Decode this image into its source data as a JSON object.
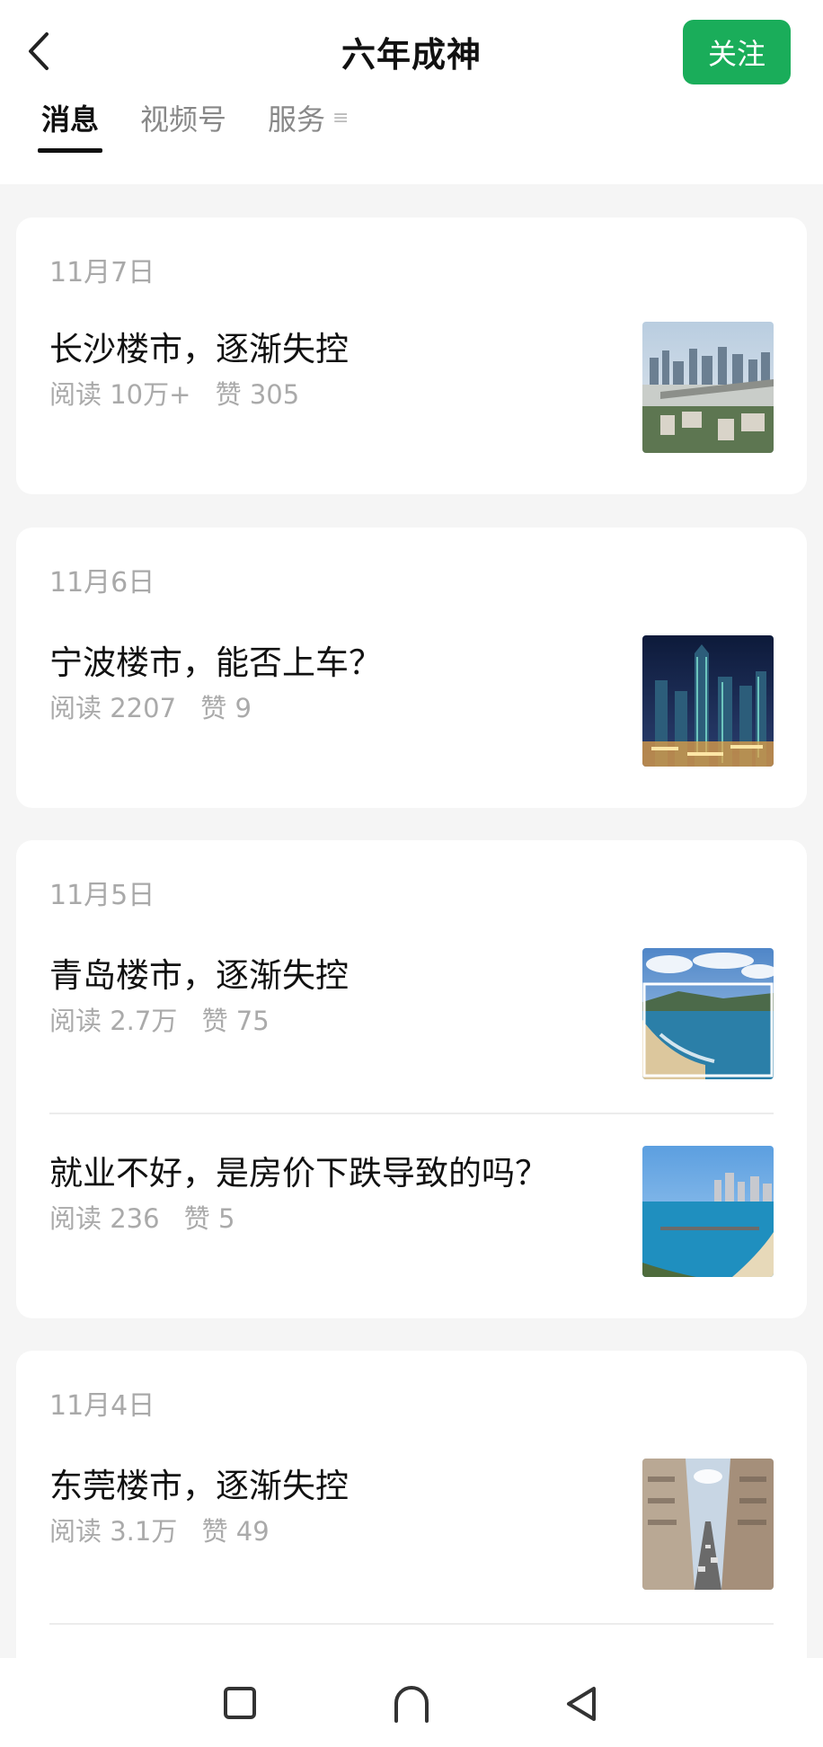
{
  "header": {
    "title": "六年成神",
    "follow_label": "关注"
  },
  "tabs": [
    {
      "label": "消息",
      "active": true
    },
    {
      "label": "视频号",
      "active": false
    },
    {
      "label": "服务",
      "active": false
    }
  ],
  "tab_more_icon": "list-icon",
  "cards": [
    {
      "date": "11月7日",
      "articles": [
        {
          "title": "长沙楼市，逐渐失控",
          "reads": "阅读 10万+",
          "likes": "赞 305",
          "thumb": "changsha-skyline-bridge"
        }
      ]
    },
    {
      "date": "11月6日",
      "articles": [
        {
          "title": "宁波楼市，能否上车？",
          "reads": "阅读 2207",
          "likes": "赞 9",
          "thumb": "ningbo-night-skyline"
        }
      ]
    },
    {
      "date": "11月5日",
      "articles": [
        {
          "title": "青岛楼市，逐渐失控",
          "reads": "阅读 2.7万",
          "likes": "赞 75",
          "thumb": "qingdao-coast"
        },
        {
          "title": "就业不好，是房价下跌导致的吗？",
          "reads": "阅读 236",
          "likes": "赞 5",
          "thumb": "qingdao-pier"
        }
      ]
    },
    {
      "date": "11月4日",
      "articles": [
        {
          "title": "东莞楼市，逐渐失控",
          "reads": "阅读 3.1万",
          "likes": "赞 49",
          "thumb": "dongguan-street"
        }
      ]
    }
  ],
  "navbar": {
    "icons": [
      "recent-apps-icon",
      "home-icon",
      "back-triangle-icon"
    ]
  },
  "colors": {
    "accent": "#1aad5a",
    "page_bg": "#f5f5f5",
    "meta_text": "#aaaaaa"
  }
}
